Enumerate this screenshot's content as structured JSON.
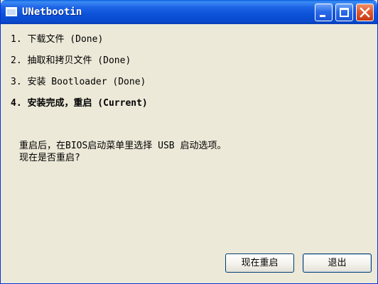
{
  "window": {
    "title": "UNetbootin"
  },
  "steps": [
    {
      "number": "1.",
      "label": "下载文件 (Done)"
    },
    {
      "number": "2.",
      "label": "抽取和拷贝文件 (Done)"
    },
    {
      "number": "3.",
      "label": "安装 Bootloader (Done)"
    },
    {
      "number": "4.",
      "label": "安装完成，重启 (Current)"
    }
  ],
  "message": {
    "line1": "重启后，在BIOS启动菜单里选择 USB 启动选项。",
    "line2": "现在是否重启?"
  },
  "buttons": {
    "reboot_label": "现在重启",
    "exit_label": "退出"
  },
  "colors": {
    "titlebar_accent": "#0a4bd0",
    "window_background": "#ece9d8",
    "close_button": "#e25a2e"
  }
}
